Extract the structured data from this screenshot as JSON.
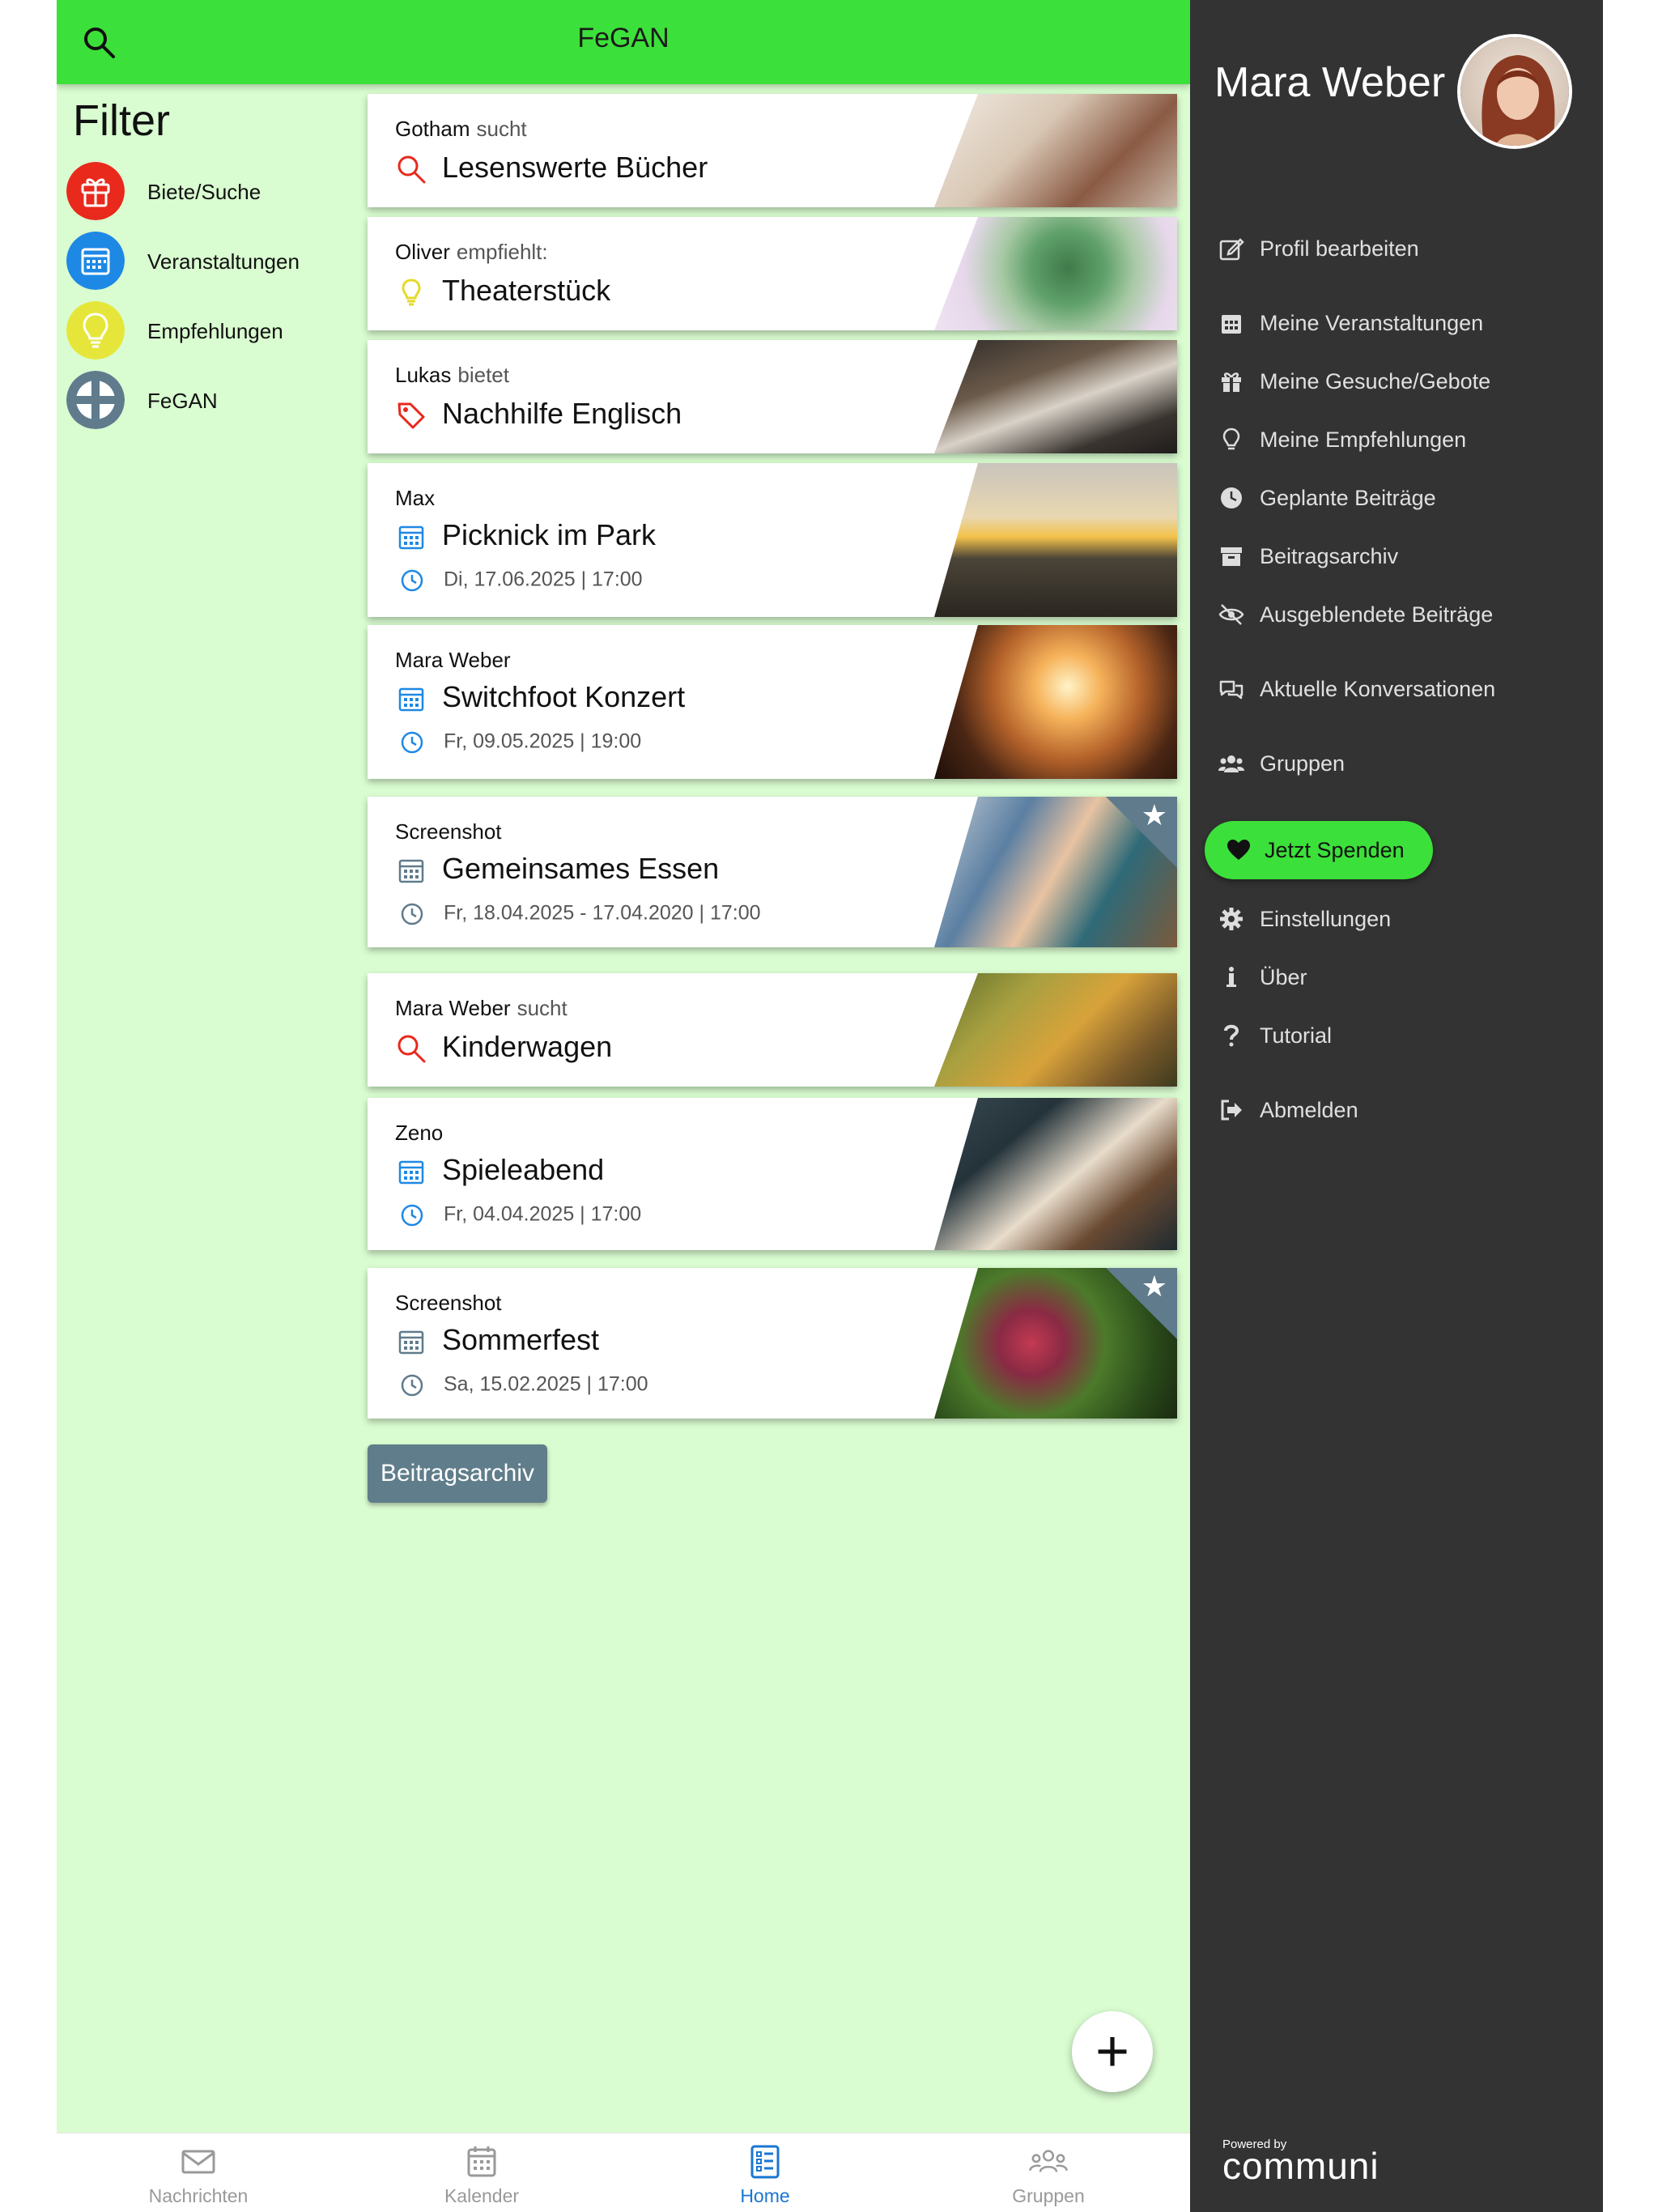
{
  "header": {
    "title": "FeGAN"
  },
  "filter": {
    "heading": "Filter",
    "items": [
      {
        "label": "Biete/Suche",
        "color": "#e8291c"
      },
      {
        "label": "Veranstaltungen",
        "color": "#1e88e5"
      },
      {
        "label": "Empfehlungen",
        "color": "#e6e63a"
      },
      {
        "label": "FeGAN",
        "color": "#5f7b8c"
      }
    ]
  },
  "feed": [
    {
      "author": "Gotham",
      "verb": "sucht",
      "title": "Lesenswerte Bücher",
      "icon": "search-icon",
      "date": "",
      "starred": false
    },
    {
      "author": "Oliver",
      "verb": "empfiehlt:",
      "title": "Theaterstück",
      "icon": "lightbulb-icon",
      "date": "",
      "starred": false
    },
    {
      "author": "Lukas",
      "verb": "bietet",
      "title": "Nachhilfe Englisch",
      "icon": "tag-icon",
      "date": "",
      "starred": false
    },
    {
      "author": "Max",
      "verb": "",
      "title": "Picknick im Park",
      "icon": "calendar-icon",
      "date": "Di, 17.06.2025 | 17:00",
      "starred": false
    },
    {
      "author": "Mara Weber",
      "verb": "",
      "title": "Switchfoot Konzert",
      "icon": "calendar-icon",
      "date": "Fr, 09.05.2025 | 19:00",
      "starred": false
    },
    {
      "author": "Screenshot",
      "verb": "",
      "title": "Gemeinsames Essen",
      "icon": "calendar-icon",
      "date": "Fr, 18.04.2025 - 17.04.2020 | 17:00",
      "starred": true
    },
    {
      "author": "Mara Weber",
      "verb": "sucht",
      "title": "Kinderwagen",
      "icon": "search-icon",
      "date": "",
      "starred": false
    },
    {
      "author": "Zeno",
      "verb": "",
      "title": "Spieleabend",
      "icon": "calendar-icon",
      "date": "Fr, 04.04.2025 | 17:00",
      "starred": false
    },
    {
      "author": "Screenshot",
      "verb": "",
      "title": "Sommerfest",
      "icon": "calendar-icon",
      "date": "Sa, 15.02.2025 | 17:00",
      "starred": true
    }
  ],
  "archive_button": "Beitragsarchiv",
  "fab": {
    "icon": "plus-icon",
    "symbol": "+"
  },
  "bottom_nav": [
    {
      "label": "Nachrichten",
      "icon": "envelope-icon"
    },
    {
      "label": "Kalender",
      "icon": "calendar-icon"
    },
    {
      "label": "Home",
      "icon": "list-icon",
      "active": true
    },
    {
      "label": "Gruppen",
      "icon": "group-icon"
    }
  ],
  "drawer": {
    "user_name": "Mara Weber",
    "menu": [
      {
        "label": "Profil bearbeiten",
        "icon": "edit-icon"
      },
      {
        "label": "Meine Veranstaltungen",
        "icon": "calendar-icon"
      },
      {
        "label": "Meine Gesuche/Gebote",
        "icon": "gift-icon"
      },
      {
        "label": "Meine Empfehlungen",
        "icon": "lightbulb-icon"
      },
      {
        "label": "Geplante Beiträge",
        "icon": "clock-icon"
      },
      {
        "label": "Beitragsarchiv",
        "icon": "archive-icon"
      },
      {
        "label": "Ausgeblendete Beiträge",
        "icon": "eye-slash-icon"
      },
      {
        "label": "Aktuelle Konversationen",
        "icon": "chat-icon"
      },
      {
        "label": "Gruppen",
        "icon": "users-icon"
      }
    ],
    "donate_label": "Jetzt Spenden",
    "menu_bottom": [
      {
        "label": "Einstellungen",
        "icon": "gear-icon"
      },
      {
        "label": "Über",
        "icon": "info-icon"
      },
      {
        "label": "Tutorial",
        "icon": "question-icon"
      },
      {
        "label": "Abmelden",
        "icon": "logout-icon"
      }
    ],
    "powered_by": "Powered by",
    "brand": "communi"
  },
  "colors": {
    "topbar": "#3ce03a",
    "background": "#d9fcd0",
    "drawer": "#333333",
    "accent_blue": "#1e88e5",
    "accent_red": "#e8291c"
  }
}
